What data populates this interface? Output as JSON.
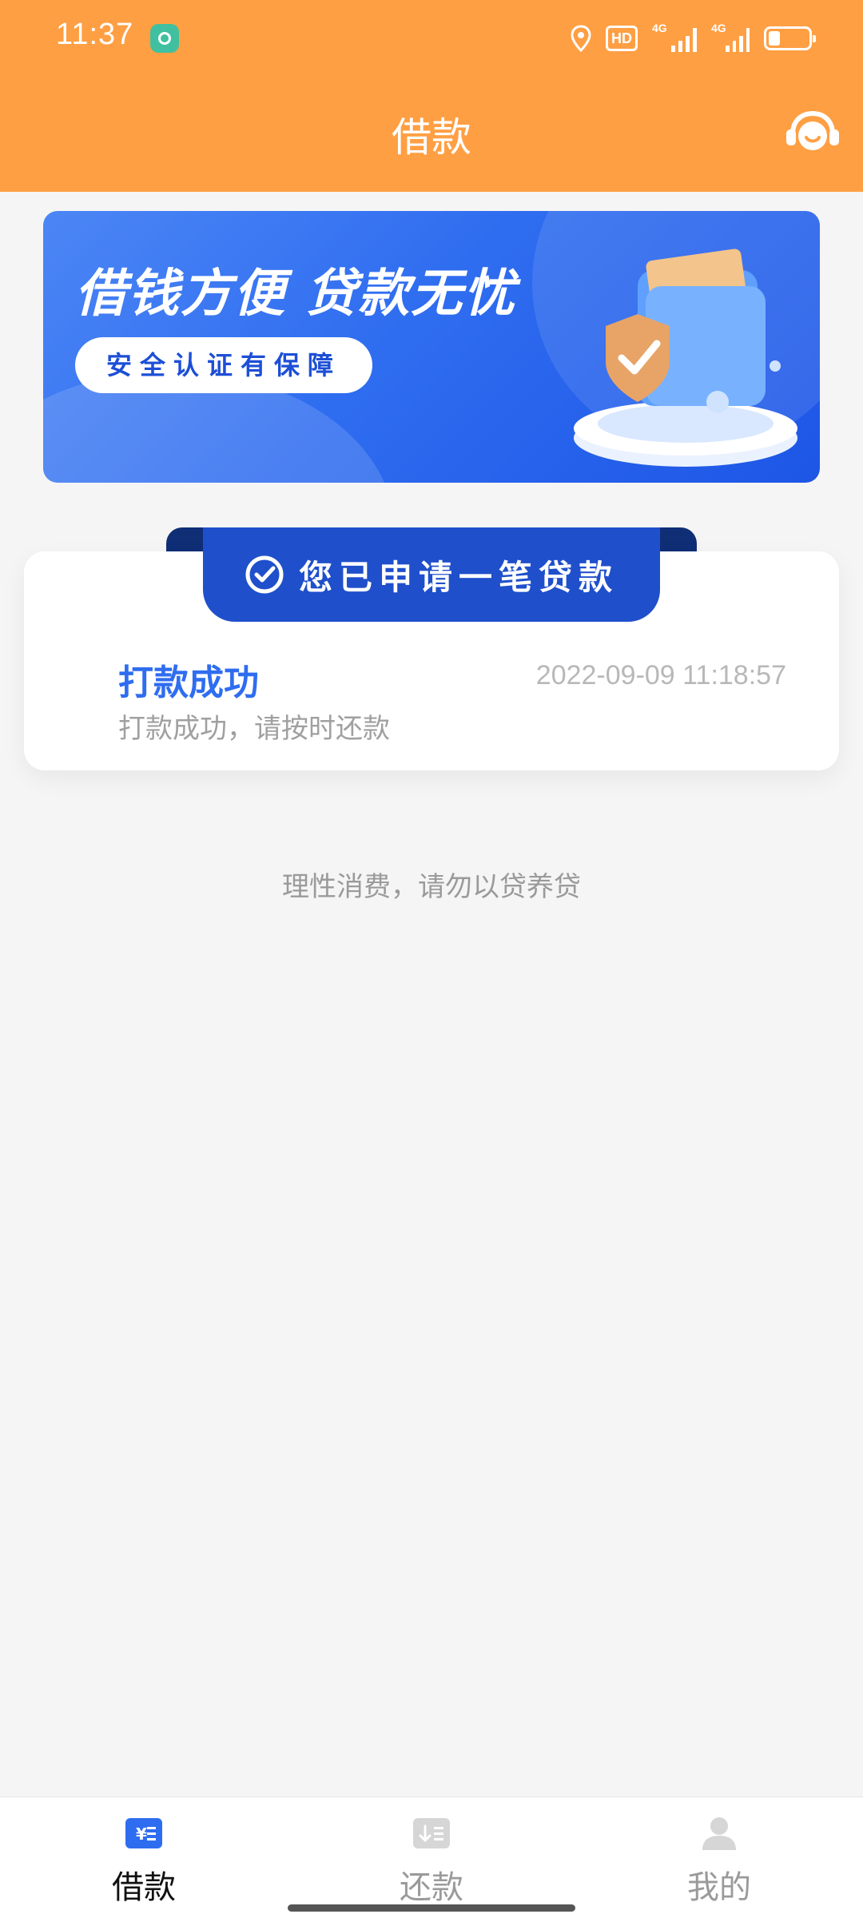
{
  "status_bar": {
    "time": "11:37",
    "hd_label": "HD",
    "signal_1_label": "4G",
    "signal_2_label": "4G"
  },
  "header": {
    "title": "借款",
    "support_icon": "customer-service-icon"
  },
  "banner": {
    "headline": "借钱方便  贷款无忧",
    "pill_text": "安全认证有保障"
  },
  "loan_card": {
    "ribbon_text": "您已申请一笔贷款",
    "status_title": "打款成功",
    "status_time": "2022-09-09 11:18:57",
    "status_desc": "打款成功，请按时还款"
  },
  "tip": "理性消费，请勿以贷养贷",
  "bottom_nav": {
    "items": [
      {
        "label": "借款",
        "icon": "loan-icon",
        "active": true
      },
      {
        "label": "还款",
        "icon": "repay-icon",
        "active": false
      },
      {
        "label": "我的",
        "icon": "profile-icon",
        "active": false
      }
    ]
  },
  "colors": {
    "header": "#FF9F43",
    "accent_blue": "#2F6DF0",
    "ribbon": "#1F4FCB"
  }
}
